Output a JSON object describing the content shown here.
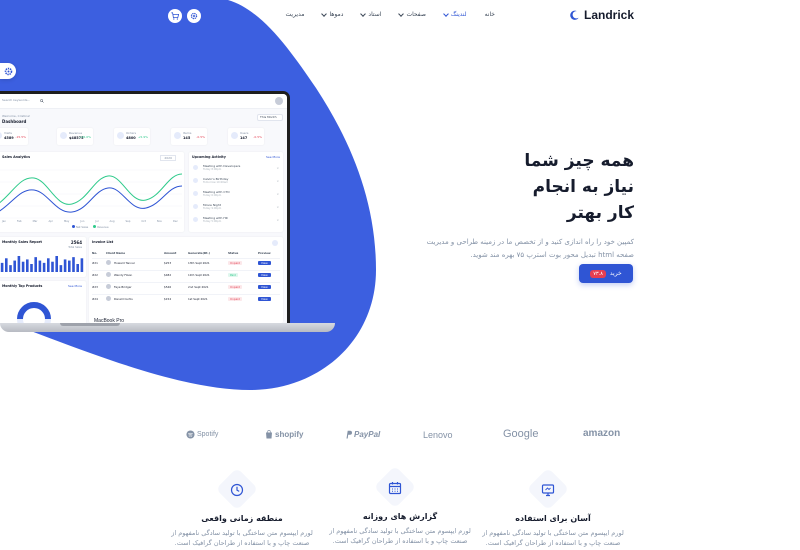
{
  "colors": {
    "primary": "#2f55d4",
    "dark": "#161c2d",
    "muted": "#8492a6",
    "danger": "#e43f52",
    "success": "#2eca8b"
  },
  "header": {
    "logo_text": "Landrick",
    "logo_icon": "crescent-logo-icon",
    "nav": [
      {
        "label": "خانه",
        "active": false,
        "dropdown": false
      },
      {
        "label": "لندینگ",
        "active": true,
        "dropdown": true
      },
      {
        "label": "صفحات",
        "active": false,
        "dropdown": true
      },
      {
        "label": "استاد",
        "active": false,
        "dropdown": true
      },
      {
        "label": "دموها",
        "active": false,
        "dropdown": true
      },
      {
        "label": "مدیریت",
        "active": false,
        "dropdown": false
      }
    ],
    "icons": [
      "cart-icon",
      "settings-icon"
    ]
  },
  "hero": {
    "title_lines": [
      "همه چیز شما",
      "نیاز به انجام",
      "کار بهتر"
    ],
    "description": "کمپین خود را راه اندازی کنید و از تخصص ما در زمینه طراحی و مدیریت صفحه html تبدیل محور بوت استرپ ۷۵ بهره مند شوید.",
    "buy_label": "خرید",
    "price": "۷۳.۸"
  },
  "laptop": {
    "label": "MacBook Pro",
    "dashboard": {
      "search_placeholder": "Search keywords...",
      "breadcrumb": "Welcome, Cristina!",
      "title": "Dashboard",
      "filter": "This Month",
      "stats": [
        {
          "label": "Visits",
          "value": "4589",
          "change": "-15.5%",
          "positive": false
        },
        {
          "label": "Revenue",
          "value": "$48575",
          "change": "+15.0%",
          "positive": true
        },
        {
          "label": "Orders",
          "value": "4800",
          "change": "+5.9%",
          "positive": true
        },
        {
          "label": "Items",
          "value": "145",
          "change": "-0.5%",
          "positive": false
        },
        {
          "label": "Users",
          "value": "147",
          "change": "-0.5%",
          "positive": false
        }
      ],
      "analytics_title": "Sales Analytics",
      "analytics_filter": "2020",
      "analytics_legend": [
        "Net Sales",
        "Revenue"
      ],
      "analytics_months": [
        "Jan",
        "Feb",
        "Mar",
        "Apr",
        "May",
        "Jun",
        "Jul",
        "Aug",
        "Sep",
        "Oct",
        "Nov",
        "Dec"
      ],
      "activity_title": "Upcoming Activity",
      "activity_link": "See More",
      "activities": [
        {
          "title": "Meeting with Developers",
          "sub": "Today 8:00pm"
        },
        {
          "title": "Calvin's Birthday",
          "sub": "Tomorrow 10:00am"
        },
        {
          "title": "Meeting with CTO",
          "sub": "Today 6:00pm"
        },
        {
          "title": "Movie Night",
          "sub": "Today 9:00pm"
        },
        {
          "title": "Meeting with HR",
          "sub": "Today 5:00pm"
        }
      ],
      "monthly_title": "Monthly Sales Report",
      "monthly_value": "2564",
      "monthly_sub": "Total Sales",
      "monthly_bars": [
        8,
        12,
        6,
        10,
        14,
        9,
        11,
        7,
        13,
        10,
        8,
        12,
        9,
        14,
        6,
        11,
        10,
        13,
        7,
        12
      ],
      "top_products_title": "Monthly Top Products",
      "top_products_link": "See More",
      "invoice_title": "Invoice List",
      "invoice_columns": [
        "No.",
        "Client Name",
        "Amount",
        "Generate(Dt.)",
        "Status",
        "Preview"
      ],
      "invoices": [
        {
          "no": "#d1",
          "name": "Howard Tanner",
          "amount": "$253",
          "date": "13th Sept 2021",
          "status": "Unpaid",
          "paid": false,
          "action": "View"
        },
        {
          "no": "#d2",
          "name": "Wendy Filson",
          "amount": "$482",
          "date": "11th Sept 2021",
          "status": "Paid",
          "paid": true,
          "action": "View"
        },
        {
          "no": "#d3",
          "name": "Faye Bridger",
          "amount": "$546",
          "date": "2nd Sept 2021",
          "status": "Unpaid",
          "paid": false,
          "action": "View"
        },
        {
          "no": "#d4",
          "name": "Ronald Curtis",
          "amount": "$154",
          "date": "1st Sept 2021",
          "status": "Unpaid",
          "paid": false,
          "action": "View"
        }
      ]
    }
  },
  "brands": [
    {
      "name": "Spotify",
      "icon": "spotify-icon"
    },
    {
      "name": "shopify",
      "icon": "shopify-bag-icon"
    },
    {
      "name": "PayPal",
      "icon": "paypal-icon"
    },
    {
      "name": "Lenovo",
      "icon": ""
    },
    {
      "name": "Google",
      "icon": ""
    },
    {
      "name": "amazon",
      "icon": ""
    }
  ],
  "features": [
    {
      "title": "آسان برای استفاده",
      "icon": "monitor-icon",
      "desc_line1": "لورم ایپسوم متن ساختگی با تولید سادگی نامفهوم از",
      "desc_line2": "صنعت چاپ و با استفاده از طراحان گرافیک است."
    },
    {
      "title": "گزارش های روزانه",
      "icon": "calendar-icon",
      "desc_line1": "لورم ایپسوم متن ساختگی با تولید سادگی نامفهوم از",
      "desc_line2": "صنعت چاپ و با استفاده از طراحان گرافیک است."
    },
    {
      "title": "منطقه زمانی واقعی",
      "icon": "clock-icon",
      "desc_line1": "لورم ایپسوم متن ساختگی با تولید سادگی نامفهوم از",
      "desc_line2": "صنعت چاپ و با استفاده از طراحان گرافیک است."
    }
  ]
}
